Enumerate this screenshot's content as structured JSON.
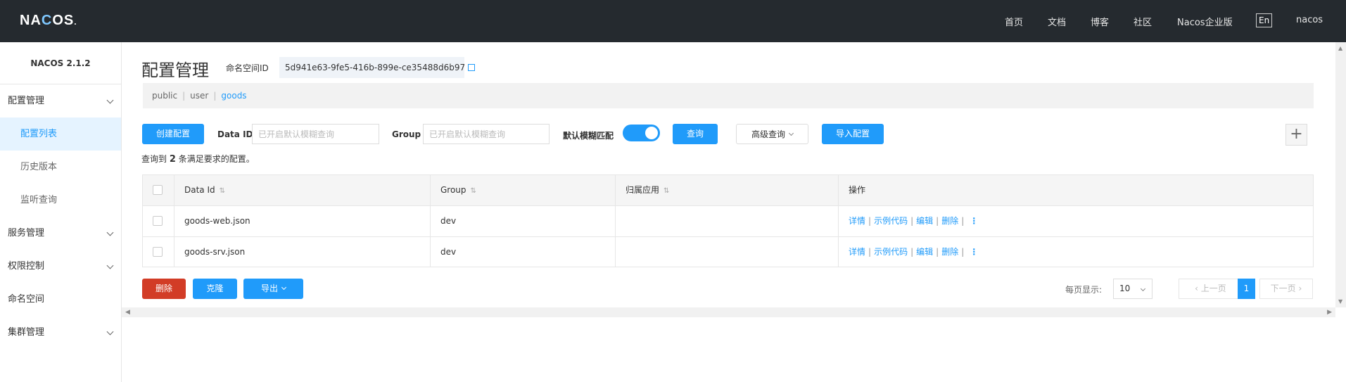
{
  "header": {
    "logo_a": "NA",
    "logo_c": "C",
    "logo_b": "OS",
    "logo_dot": ".",
    "nav": [
      "首页",
      "文档",
      "博客",
      "社区",
      "Nacos企业版"
    ],
    "lang": "En",
    "user": "nacos"
  },
  "sidebar": {
    "version": "NACOS 2.1.2",
    "items": [
      {
        "label": "配置管理"
      },
      {
        "label": "配置列表"
      },
      {
        "label": "历史版本"
      },
      {
        "label": "监听查询"
      },
      {
        "label": "服务管理"
      },
      {
        "label": "权限控制"
      },
      {
        "label": "命名空间"
      },
      {
        "label": "集群管理"
      }
    ]
  },
  "page": {
    "title": "配置管理",
    "ns_label": "命名空间ID",
    "ns_id": "5d941e63-9fe5-416b-899e-ce35488d6b97",
    "crumbs": [
      "public",
      "user",
      "goods"
    ]
  },
  "toolbar": {
    "create": "创建配置",
    "dataid_label": "Data ID",
    "dataid_placeholder": "已开启默认模糊查询",
    "group_label": "Group",
    "group_placeholder": "已开启默认模糊查询",
    "fuzzy_label": "默认模糊匹配",
    "fuzzy_on": true,
    "query": "查询",
    "advanced": "高级查询",
    "import": "导入配置",
    "plus": "+"
  },
  "result": {
    "prefix": "查询到",
    "count": "2",
    "suffix": "条满足要求的配置。"
  },
  "table": {
    "headers": [
      "Data Id",
      "Group",
      "归属应用",
      "操作"
    ],
    "sort_glyph": "⇅",
    "rows": [
      {
        "dataid": "goods-web.json",
        "group": "dev",
        "app": ""
      },
      {
        "dataid": "goods-srv.json",
        "group": "dev",
        "app": ""
      }
    ],
    "ops": [
      "详情",
      "示例代码",
      "编辑",
      "删除"
    ],
    "more": "⋮"
  },
  "footer": {
    "delete": "删除",
    "clone": "克隆",
    "export": "导出",
    "page_size_label": "每页显示:",
    "page_size": "10",
    "prev": "上一页",
    "page": "1",
    "next": "下一页"
  }
}
